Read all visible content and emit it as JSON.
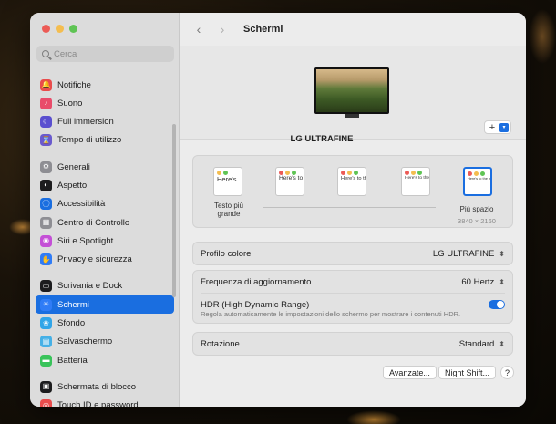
{
  "window": {
    "title": "Schermi"
  },
  "search": {
    "placeholder": "Cerca"
  },
  "sidebar": {
    "items": [
      {
        "label": "Notifiche",
        "icon": "bell-icon",
        "color": "#e94c4c"
      },
      {
        "label": "Suono",
        "icon": "speaker-icon",
        "color": "#e94c6a"
      },
      {
        "label": "Full immersion",
        "icon": "moon-icon",
        "color": "#5a4fcf"
      },
      {
        "label": "Tempo di utilizzo",
        "icon": "hourglass-icon",
        "color": "#6a5acd"
      },
      {
        "label": "Generali",
        "icon": "gear-icon",
        "color": "#8e8e93"
      },
      {
        "label": "Aspetto",
        "icon": "appearance-icon",
        "color": "#1c1c1e"
      },
      {
        "label": "Accessibilità",
        "icon": "accessibility-icon",
        "color": "#1a6ee0"
      },
      {
        "label": "Centro di Controllo",
        "icon": "control-center-icon",
        "color": "#8e8e93"
      },
      {
        "label": "Siri e Spotlight",
        "icon": "siri-icon",
        "color": "#c44fd6"
      },
      {
        "label": "Privacy e sicurezza",
        "icon": "hand-icon",
        "color": "#2f7cf6"
      },
      {
        "label": "Scrivania e Dock",
        "icon": "dock-icon",
        "color": "#1c1c1e"
      },
      {
        "label": "Schermi",
        "icon": "display-icon",
        "color": "#2f7cf6"
      },
      {
        "label": "Sfondo",
        "icon": "wallpaper-icon",
        "color": "#31a5e8"
      },
      {
        "label": "Salvaschermo",
        "icon": "screensaver-icon",
        "color": "#45b0e6"
      },
      {
        "label": "Batteria",
        "icon": "battery-icon",
        "color": "#39c35a"
      },
      {
        "label": "Schermata di blocco",
        "icon": "lock-screen-icon",
        "color": "#1c1c1e"
      },
      {
        "label": "Touch ID e password",
        "icon": "fingerprint-icon",
        "color": "#e94c4c"
      }
    ],
    "active": "Schermi"
  },
  "header": {
    "title": "Schermi"
  },
  "monitor": {
    "name": "LG ULTRAFINE"
  },
  "resolution": {
    "options": [
      {
        "preview": "Here's",
        "selected": false
      },
      {
        "preview": "Here's to troublem",
        "selected": false
      },
      {
        "preview": "Here's to the troublemakers ones who",
        "selected": false
      },
      {
        "preview": "Here's to the troublemakers ones who see t rules. And the",
        "selected": false
      },
      {
        "preview": "Here's to the troublemakers ones who see t rules. And the",
        "selected": true
      }
    ],
    "min_label": "Testo più grande",
    "max_label": "Più spazio",
    "max_resolution": "3840 × 2160"
  },
  "settings": {
    "color_profile_label": "Profilo colore",
    "color_profile_value": "LG ULTRAFINE",
    "refresh_label": "Frequenza di aggiornamento",
    "refresh_value": "60 Hertz",
    "hdr_label": "HDR (High Dynamic Range)",
    "hdr_desc": "Regola automaticamente le impostazioni dello schermo per mostrare i contenuti HDR.",
    "hdr_on": true,
    "rotation_label": "Rotazione",
    "rotation_value": "Standard"
  },
  "footer": {
    "advanced_label": "Avanzate...",
    "night_shift_label": "Night Shift...",
    "help_label": "?"
  }
}
